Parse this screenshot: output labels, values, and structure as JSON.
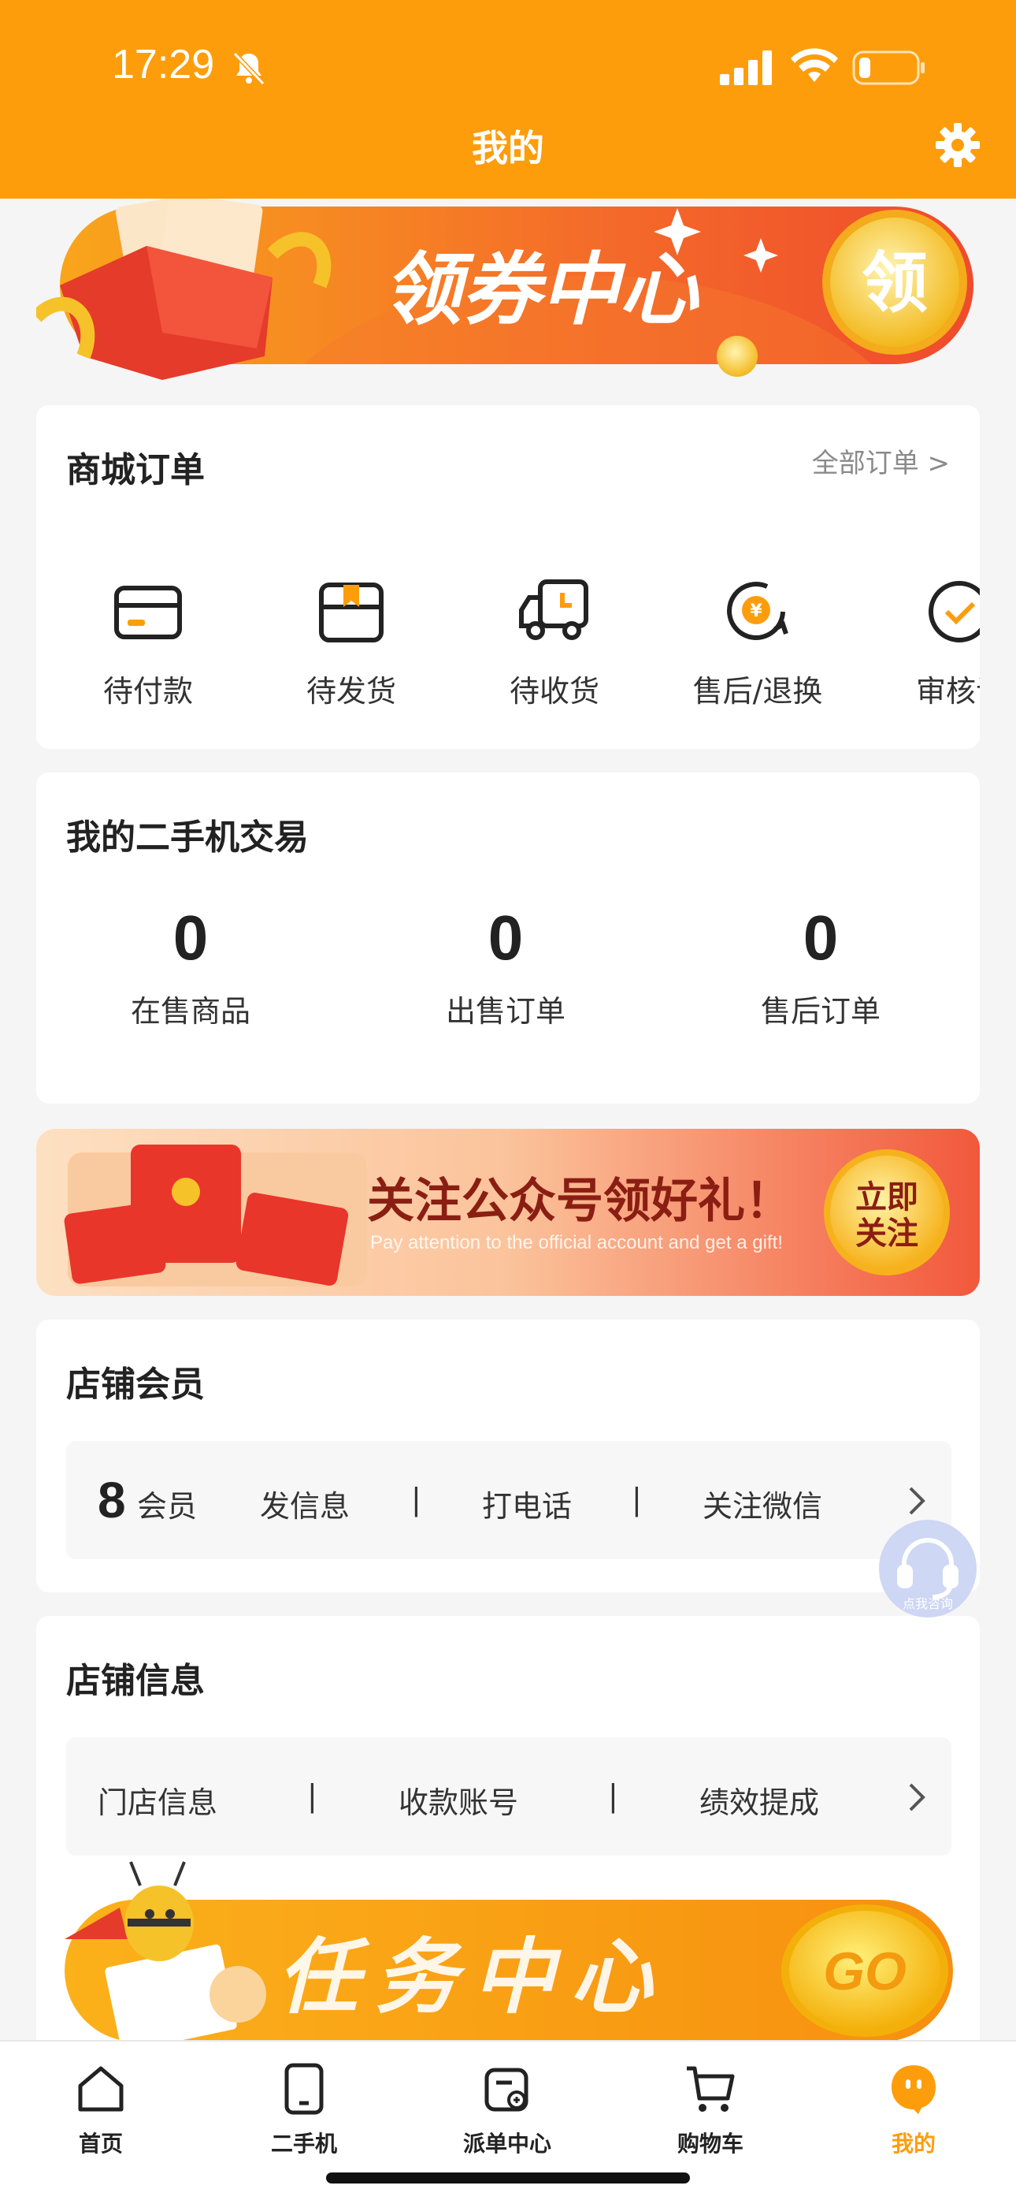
{
  "status_bar": {
    "time": "17:29"
  },
  "header": {
    "title": "我的"
  },
  "coupon_banner": {
    "text": "领券中心",
    "badge": "领"
  },
  "orders": {
    "title": "商城订单",
    "all_link": "全部订单 >",
    "items": [
      {
        "label": "待付款",
        "icon": "card-icon"
      },
      {
        "label": "待发货",
        "icon": "box-icon"
      },
      {
        "label": "待收货",
        "icon": "truck-icon"
      },
      {
        "label": "售后/退换",
        "icon": "refund-icon"
      },
      {
        "label": "审核订",
        "icon": "review-icon"
      }
    ]
  },
  "trade": {
    "title": "我的二手机交易",
    "stats": [
      {
        "value": "0",
        "label": "在售商品"
      },
      {
        "value": "0",
        "label": "出售订单"
      },
      {
        "value": "0",
        "label": "售后订单"
      }
    ]
  },
  "follow_banner": {
    "text": "关注公众号领好礼！",
    "subtext": "Pay attention to the official account and get a gift!",
    "button_line1": "立即",
    "button_line2": "关注"
  },
  "member": {
    "title": "店铺会员",
    "count": "8",
    "count_label": "会员",
    "actions": [
      "发信息",
      "打电话",
      "关注微信"
    ],
    "separator": "|"
  },
  "service": {
    "label": "点我咨询"
  },
  "shop_info": {
    "title": "店铺信息",
    "actions": [
      "门店信息",
      "收款账号",
      "绩效提成"
    ],
    "separator": "|"
  },
  "task_banner": {
    "text": "任务中心",
    "button": "GO"
  },
  "tabbar": {
    "items": [
      {
        "label": "首页",
        "icon": "home-icon"
      },
      {
        "label": "二手机",
        "icon": "phone-icon"
      },
      {
        "label": "派单中心",
        "icon": "dispatch-icon"
      },
      {
        "label": "购物车",
        "icon": "cart-icon"
      },
      {
        "label": "我的",
        "icon": "profile-icon",
        "active": true
      }
    ]
  },
  "colors": {
    "brand": "#fd9d0c",
    "banner_red": "#f06a2a"
  }
}
